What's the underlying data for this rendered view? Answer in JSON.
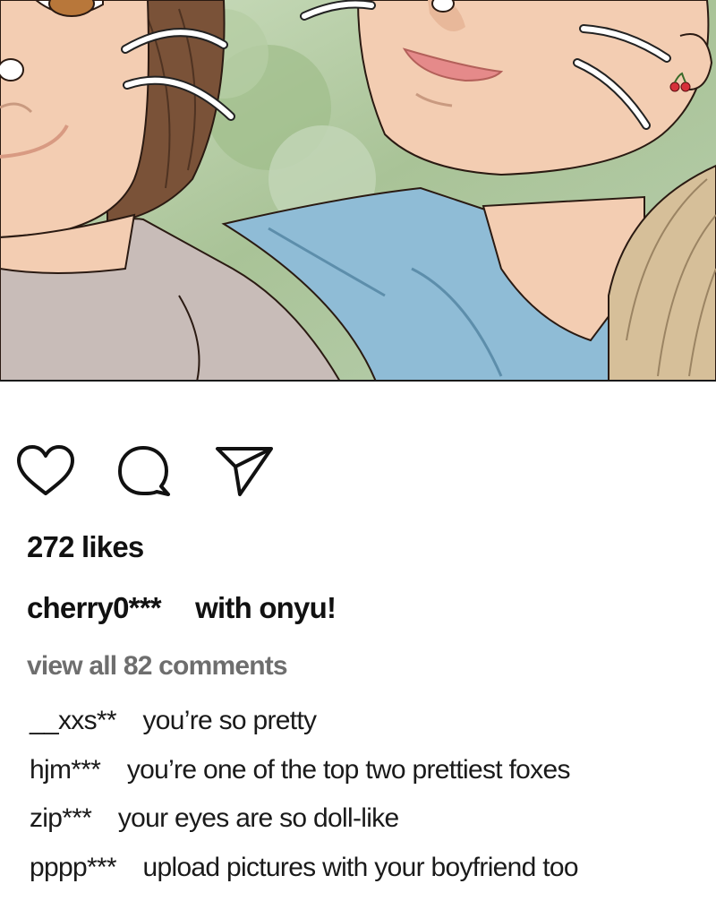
{
  "post": {
    "likes": "272 likes",
    "author": "cherry0***",
    "caption": "with onyu!",
    "view_all": "view all 82 comments"
  },
  "actions": [
    {
      "name": "like",
      "icon": "heart-icon"
    },
    {
      "name": "comment",
      "icon": "comment-bubble-icon"
    },
    {
      "name": "share",
      "icon": "send-icon"
    }
  ],
  "comments": [
    {
      "user": "__xxs**",
      "text": "you’re so pretty"
    },
    {
      "user": "hjm***",
      "text": "you’re one of the top two prettiest foxes"
    },
    {
      "user": "zip***",
      "text": "your eyes are so doll-like"
    },
    {
      "user": "pppp***",
      "text": "upload pictures with your boyfriend too"
    }
  ],
  "colors": {
    "background": "#ffffff",
    "text": "#111111",
    "muted": "#6e6e6e",
    "skin": "#f3cdb2",
    "shirt_blue": "#8fbcd6",
    "shirt_grey": "#c8bcb8",
    "hair_brown": "#7a5238",
    "hair_blonde": "#d6bf99",
    "foliage": "#a9c397"
  }
}
